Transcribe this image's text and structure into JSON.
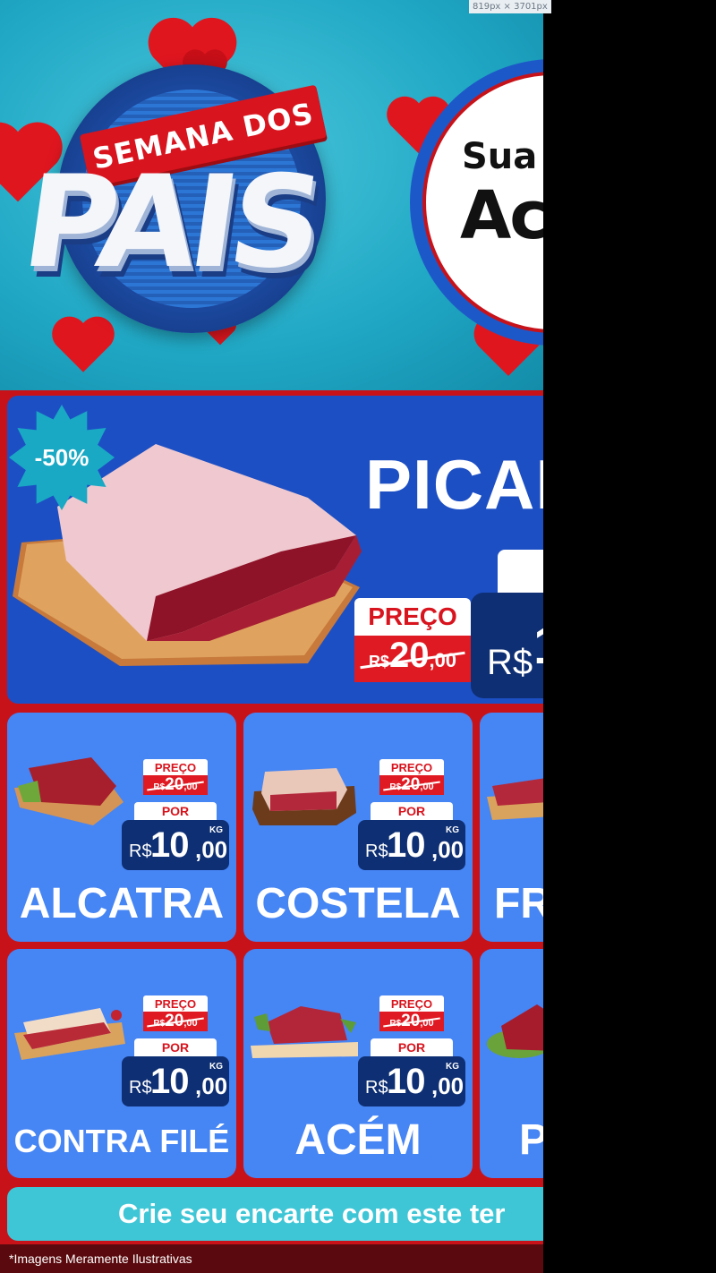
{
  "ruler": {
    "dimensions": "819px × 3701px"
  },
  "hero": {
    "ribbon_text": "SEMANA DOS",
    "title": "PAIS",
    "circle_line1": "Sua",
    "circle_line2": "Ac"
  },
  "featured": {
    "discount": "-50%",
    "name": "PICAN",
    "old_label": "PREÇO",
    "old_currency": "R$",
    "old_int": "20",
    "old_dec": ",00",
    "new_currency": "R$",
    "new_int": "1"
  },
  "cards": [
    {
      "name": "ALCATRA",
      "preco_label": "PREÇO",
      "old_currency": "R$",
      "old_int": "20",
      "old_dec": ",00",
      "por_label": "POR",
      "currency": "R$",
      "int": "10",
      "dec": ",00",
      "unit": "KG"
    },
    {
      "name": "COSTELA",
      "preco_label": "PREÇO",
      "old_currency": "R$",
      "old_int": "20",
      "old_dec": ",00",
      "por_label": "POR",
      "currency": "R$",
      "int": "10",
      "dec": ",00",
      "unit": "KG"
    },
    {
      "name": "FRA"
    },
    {
      "name": "CONTRA FILÉ",
      "preco_label": "PREÇO",
      "old_currency": "R$",
      "old_int": "20",
      "old_dec": ",00",
      "por_label": "POR",
      "currency": "R$",
      "int": "10",
      "dec": ",00",
      "unit": "KG"
    },
    {
      "name": "ACÉM",
      "preco_label": "PREÇO",
      "old_currency": "R$",
      "old_int": "20",
      "old_dec": ",00",
      "por_label": "POR",
      "currency": "R$",
      "int": "10",
      "dec": ",00",
      "unit": "KG"
    },
    {
      "name": "P"
    }
  ],
  "cta": {
    "text": "Crie seu encarte com este ter"
  },
  "footer": {
    "disclaimer": "*Imagens Meramente Ilustrativas"
  },
  "colors": {
    "brand_red": "#c8121a",
    "brand_blue": "#1d4fc4",
    "card_blue": "#4685f4",
    "price_navy": "#0e2f73",
    "cta_teal": "#3ec6d6"
  }
}
